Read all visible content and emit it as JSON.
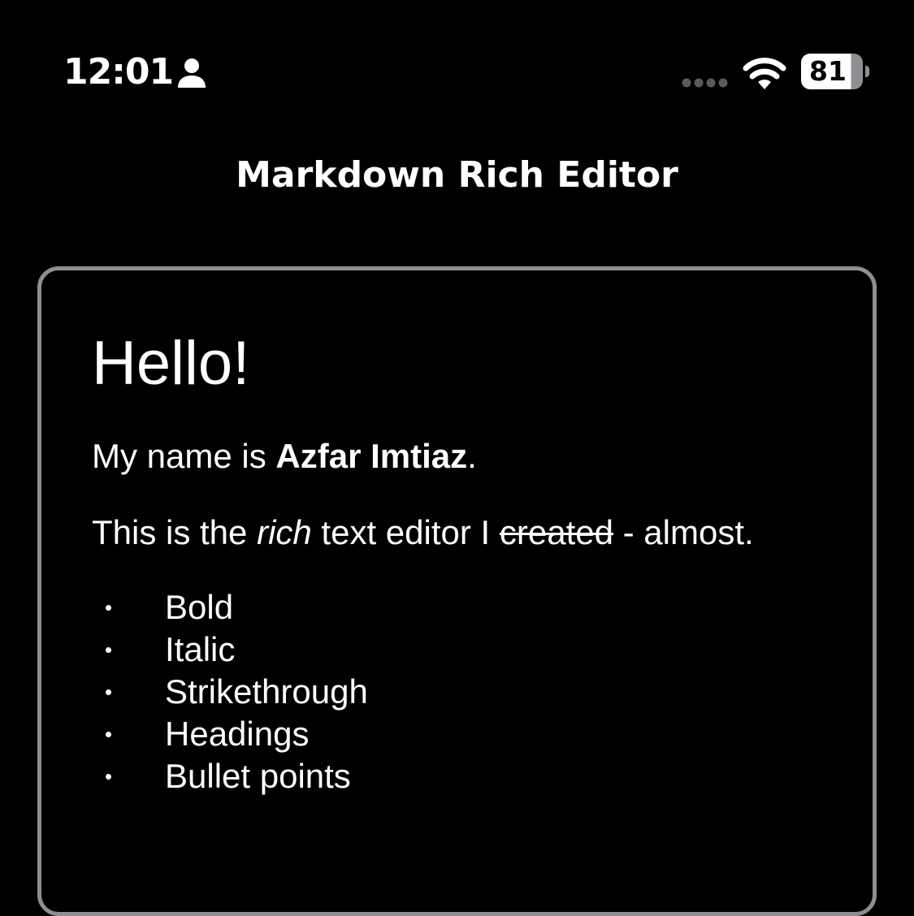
{
  "status_bar": {
    "time": "12:01",
    "battery_level": "81",
    "icons": [
      "person-icon",
      "signal-icon",
      "wifi-icon",
      "battery-icon"
    ]
  },
  "nav": {
    "title": "Markdown Rich Editor"
  },
  "editor": {
    "heading": "Hello!",
    "paragraph_1": {
      "prefix": "My name is ",
      "bold": "Azfar Imtiaz",
      "suffix": "."
    },
    "paragraph_2": {
      "prefix": "This is the ",
      "italic": "rich",
      "middle": " text editor I ",
      "strikethrough": "created",
      "suffix": " - almost."
    },
    "bullets": [
      {
        "label": "Bold"
      },
      {
        "label": "Italic"
      },
      {
        "label": "Strikethrough"
      },
      {
        "label": "Headings"
      },
      {
        "label": "Bullet points"
      }
    ]
  },
  "colors": {
    "background": "#000000",
    "text": "#ffffff",
    "border": "#8e8e93"
  }
}
